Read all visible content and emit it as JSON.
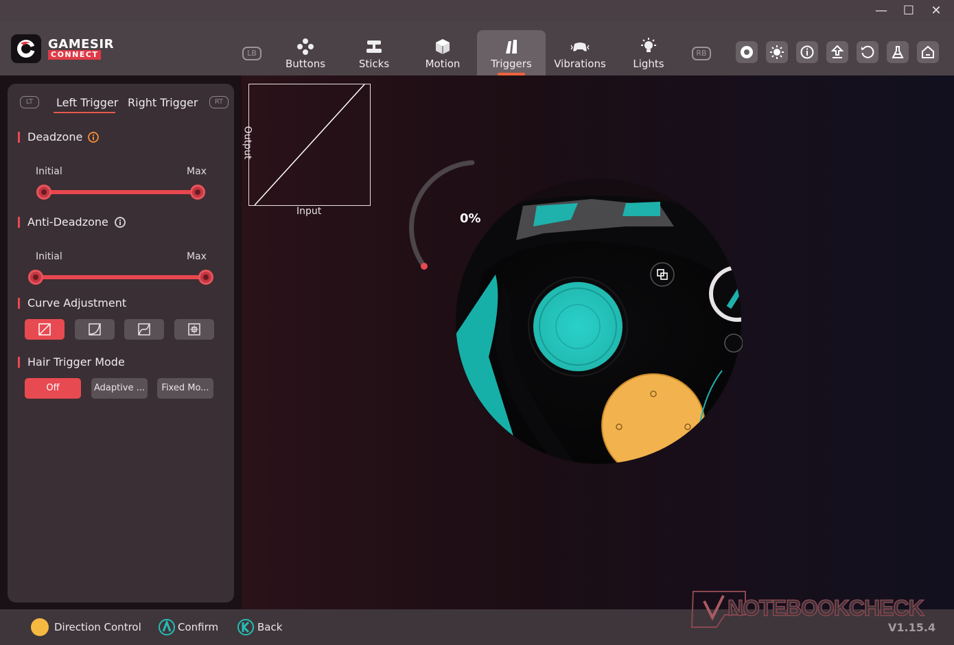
{
  "window": {
    "minimize": "—",
    "maximize": "☐",
    "close": "✕"
  },
  "brand": {
    "name": "GAMESIR",
    "sub": "CONNECT"
  },
  "bumpers": {
    "left": "LB",
    "right": "RB"
  },
  "nav": [
    {
      "label": "Buttons",
      "icon": "gamepad-buttons-icon",
      "active": false
    },
    {
      "label": "Sticks",
      "icon": "joystick-icon",
      "active": false
    },
    {
      "label": "Motion",
      "icon": "cube-icon",
      "active": false
    },
    {
      "label": "Triggers",
      "icon": "trigger-icon",
      "active": true
    },
    {
      "label": "Vibrations",
      "icon": "controller-vibration-icon",
      "active": false
    },
    {
      "label": "Lights",
      "icon": "bulb-icon",
      "active": false
    }
  ],
  "toolbar": [
    {
      "name": "record-icon"
    },
    {
      "name": "brightness-icon"
    },
    {
      "name": "info-icon"
    },
    {
      "name": "upload-icon"
    },
    {
      "name": "reset-icon"
    },
    {
      "name": "flask-icon"
    },
    {
      "name": "home-icon"
    }
  ],
  "sidebar": {
    "lt_badge": "LT",
    "rt_badge": "RT",
    "tabs": [
      {
        "label": "Left Trigger",
        "active": true
      },
      {
        "label": "Right Trigger",
        "active": false
      }
    ],
    "deadzone": {
      "title": "Deadzone",
      "initial_label": "Initial",
      "max_label": "Max",
      "initial_value": 0,
      "max_value": 100
    },
    "anti_deadzone": {
      "title": "Anti-Deadzone",
      "initial_label": "Initial",
      "max_label": "Max",
      "initial_value": 0,
      "max_value": 100
    },
    "curve": {
      "title": "Curve Adjustment",
      "options": [
        {
          "icon": "linear-curve-icon",
          "active": true
        },
        {
          "icon": "slow-curve-icon",
          "active": false
        },
        {
          "icon": "step-curve-icon",
          "active": false
        },
        {
          "icon": "custom-curve-icon",
          "active": false
        }
      ]
    },
    "hair_trigger": {
      "title": "Hair Trigger Mode",
      "options": [
        {
          "label": "Off",
          "active": true
        },
        {
          "label": "Adaptive ...",
          "active": false
        },
        {
          "label": "Fixed Mo...",
          "active": false
        }
      ]
    }
  },
  "graph": {
    "output_label": "Output",
    "input_label": "Input"
  },
  "trigger_readout": {
    "percent": "0%",
    "value": 0
  },
  "footer": [
    {
      "label": "Direction Control",
      "icon": "dpad-circle-icon",
      "color": "#f5b942"
    },
    {
      "label": "Confirm",
      "icon": "a-button-icon",
      "color": "#23bfb5"
    },
    {
      "label": "Back",
      "icon": "b-button-icon",
      "color": "#23bfb5"
    }
  ],
  "watermark": "NOTEBOOKCHECK",
  "version": "V1.15.4",
  "colors": {
    "accent": "#e84a52",
    "tab_underline": "#f0623c",
    "teal": "#23bfb5",
    "yellow": "#f5b942"
  }
}
